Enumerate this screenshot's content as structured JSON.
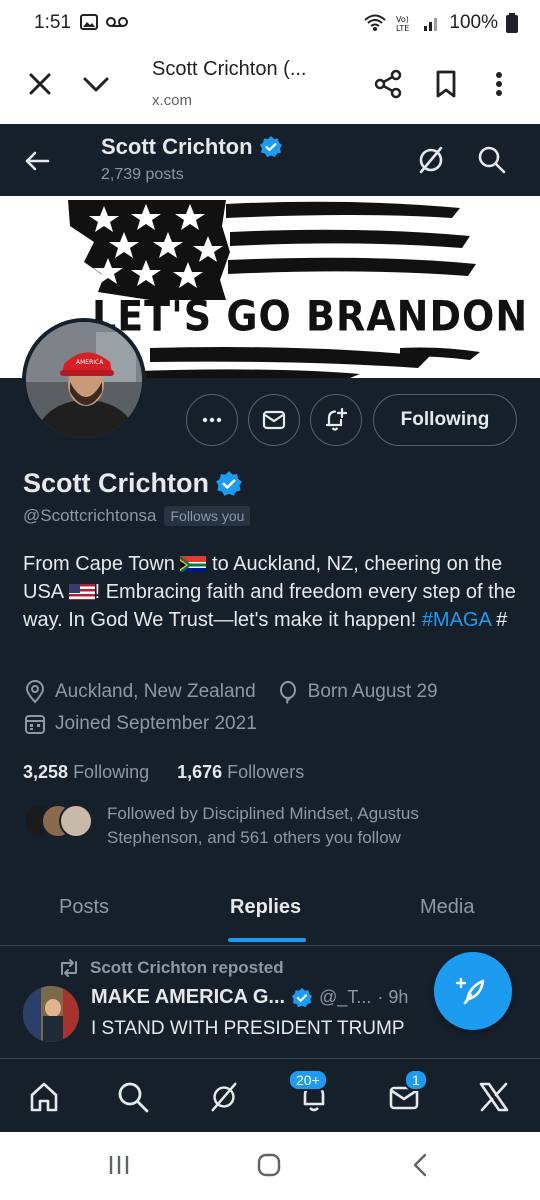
{
  "status_bar": {
    "time": "1:51",
    "battery": "100%"
  },
  "browser": {
    "title": "Scott Crichton (...",
    "url": "x.com"
  },
  "header": {
    "name": "Scott Crichton",
    "posts": "2,739 posts"
  },
  "banner": {
    "text": "LET'S GO BRANDON"
  },
  "actions": {
    "following_label": "Following"
  },
  "profile": {
    "name": "Scott Crichton",
    "handle": "@Scottcrichtonsa",
    "follows_you": "Follows you",
    "bio_part1": "From Cape Town ",
    "bio_part2": " to Auckland, NZ, cheering on the USA ",
    "bio_part3": "! Embracing faith and freedom every step of the way. In God We Trust—let's make it happen! ",
    "bio_hashtag": "#MAGA",
    "bio_part4": " #",
    "location": "Auckland, New Zealand",
    "birthday": "Born August 29",
    "joined": "Joined September 2021",
    "following_count": "3,258",
    "following_label": "Following",
    "followers_count": "1,676",
    "followers_label": "Followers",
    "followed_by": "Followed by Disciplined Mindset, Agustus Stephenson, and 561 others you follow"
  },
  "tabs": [
    {
      "label": "Posts"
    },
    {
      "label": "Replies"
    },
    {
      "label": "Media"
    }
  ],
  "tweet": {
    "repost_label": "Scott Crichton reposted",
    "author": "MAKE AMERICA G...",
    "handle": "@_T...",
    "time": "· 9h",
    "text": "I STAND WITH PRESIDENT TRUMP"
  },
  "bottom_nav": {
    "notifications_badge": "20+",
    "messages_badge": "1"
  },
  "colors": {
    "background": "#15202b",
    "accent": "#1d9bf0",
    "muted": "#8b98a5",
    "verified": "#1d9bf0"
  }
}
